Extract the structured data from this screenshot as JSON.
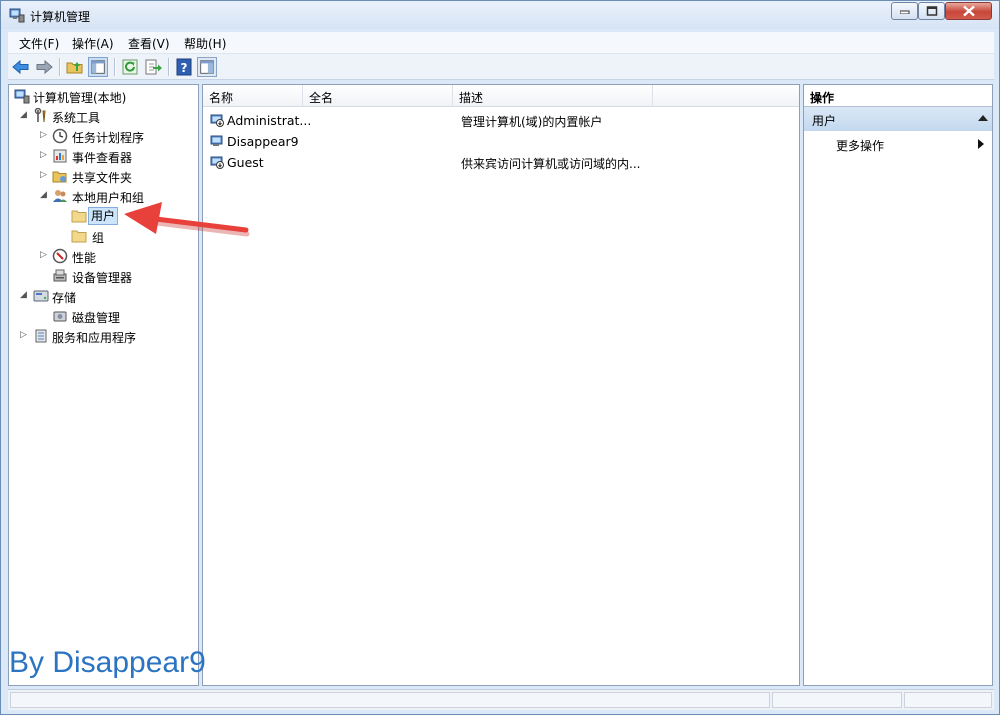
{
  "window": {
    "title": "计算机管理"
  },
  "menubar": {
    "items": [
      "文件(F)",
      "操作(A)",
      "查看(V)",
      "帮助(H)"
    ]
  },
  "tree": {
    "items": [
      {
        "label": "计算机管理(本地)",
        "icon": "computer-management-icon"
      },
      {
        "label": "系统工具",
        "icon": "tools-icon"
      },
      {
        "label": "任务计划程序",
        "icon": "clock-icon"
      },
      {
        "label": "事件查看器",
        "icon": "event-viewer-icon"
      },
      {
        "label": "共享文件夹",
        "icon": "shared-folder-icon"
      },
      {
        "label": "本地用户和组",
        "icon": "users-group-icon"
      },
      {
        "label": "用户",
        "icon": "folder-icon"
      },
      {
        "label": "组",
        "icon": "folder-icon"
      },
      {
        "label": "性能",
        "icon": "performance-icon"
      },
      {
        "label": "设备管理器",
        "icon": "device-manager-icon"
      },
      {
        "label": "存储",
        "icon": "storage-icon"
      },
      {
        "label": "磁盘管理",
        "icon": "disk-icon"
      },
      {
        "label": "服务和应用程序",
        "icon": "services-icon"
      }
    ]
  },
  "list": {
    "columns": [
      "名称",
      "全名",
      "描述"
    ],
    "rows": [
      {
        "name": "Administrat...",
        "full_name": "",
        "description": "管理计算机(域)的内置帐户"
      },
      {
        "name": "Disappear9",
        "full_name": "",
        "description": ""
      },
      {
        "name": "Guest",
        "full_name": "",
        "description": "供来宾访问计算机或访问域的内..."
      }
    ]
  },
  "actions": {
    "header": "操作",
    "section": "用户",
    "more": "更多操作"
  },
  "watermark": "By Disappear9",
  "colors": {
    "annotation_arrow": "#e8403a",
    "watermark": "#2a74c2",
    "selection": "#cce5fb"
  }
}
